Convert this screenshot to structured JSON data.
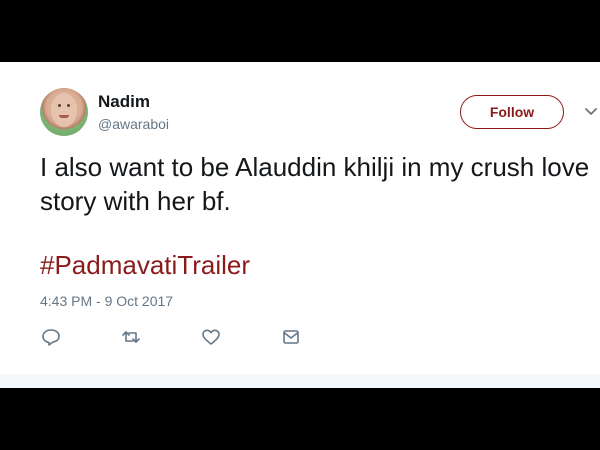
{
  "tweet": {
    "author": {
      "display_name": "Nadim",
      "handle": "@awaraboi"
    },
    "follow_label": "Follow",
    "text": "I also want to be Alauddin khilji in my crush love story with her bf.",
    "hashtag": "#PadmavatiTrailer",
    "timestamp": "4:43 PM - 9 Oct 2017",
    "actions": [
      {
        "icon": "reply-icon"
      },
      {
        "icon": "retweet-icon"
      },
      {
        "icon": "like-icon"
      },
      {
        "icon": "direct-message-icon"
      }
    ]
  },
  "colors": {
    "accent": "#8b1a1a",
    "text": "#14171a",
    "muted": "#657786",
    "frame": "#000000"
  }
}
